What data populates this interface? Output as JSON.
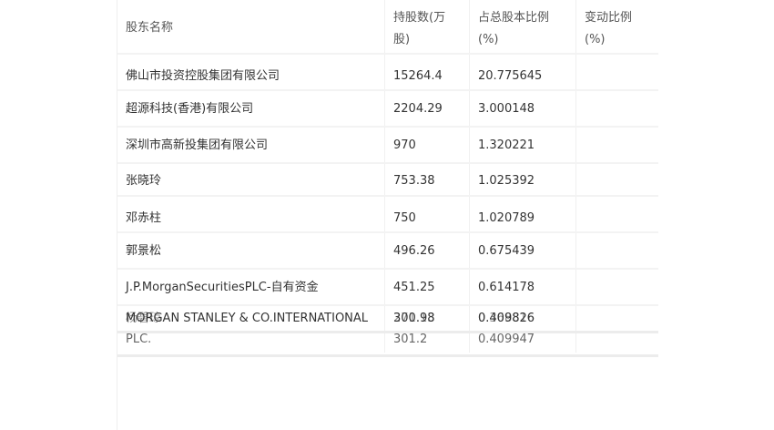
{
  "table": {
    "headers": {
      "name": "股东名称",
      "shares_line1": "持股数(万",
      "shares_line2": "股)",
      "ratio_line1": "占总股本比例",
      "ratio_line2": "(%)",
      "change_line1": "变动比例",
      "change_line2": "(%)"
    },
    "rows": [
      {
        "name": "佛山市投资控股集团有限公司",
        "shares": "15264.4",
        "ratio": "20.775645",
        "change": ""
      },
      {
        "name": "超源科技(香港)有限公司",
        "shares": "2204.29",
        "ratio": "3.000148",
        "change": ""
      },
      {
        "name": "深圳市高新投集团有限公司",
        "shares": "970",
        "ratio": "1.320221",
        "change": ""
      },
      {
        "name": "张晓玲",
        "shares": "753.38",
        "ratio": "1.025392",
        "change": ""
      },
      {
        "name": "邓赤柱",
        "shares": "750",
        "ratio": "1.020789",
        "change": ""
      },
      {
        "name": "郭景松",
        "shares": "496.26",
        "ratio": "0.675439",
        "change": ""
      },
      {
        "name": "J.P.MorganSecuritiesPLC-自有资金",
        "shares": "451.25",
        "ratio": "0.614178",
        "change": ""
      },
      {
        "name": "MORGAN STANLEY & CO.INTERNATIONAL",
        "shares": "300.98",
        "ratio": "0.409826",
        "change": ""
      }
    ],
    "overlap_row": {
      "name": "杨碧琼",
      "shares": "271.13",
      "ratio": "0.368816",
      "change": ""
    },
    "ghost_row": {
      "name": "PLC.",
      "shares": "301.2",
      "ratio": "0.409947"
    }
  }
}
